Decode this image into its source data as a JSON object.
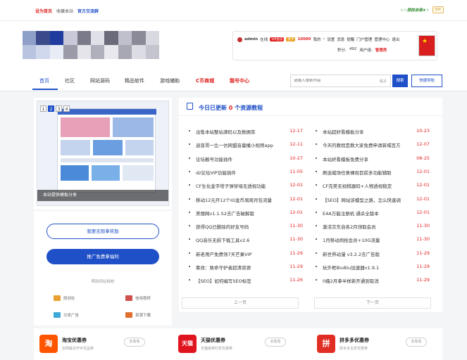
{
  "topbar": {
    "set_home": "设为首页",
    "bookmark": "收藏本站",
    "official": "官方交流群",
    "slogan": "☆☆授技自我★☆",
    "diy": "DIY"
  },
  "colors": {
    "primary": "#2050c8",
    "red": "#e02222",
    "tmall": "#e0141e",
    "taobao": "#ff5500",
    "pdd": "#e02e24"
  },
  "user": {
    "name": "admin",
    "status": "在线",
    "badge": "VIP会员",
    "gold": "金币",
    "coins": "10000",
    "my": "我的",
    "links": [
      "设置",
      "消息",
      "提醒",
      "门户管理",
      "管理中心",
      "退出"
    ],
    "score_label": "积分:",
    "score": "492",
    "group_label": "用户组:",
    "group": "管理员"
  },
  "nav": {
    "items": [
      "首页",
      "社区",
      "网站源码",
      "精品软件",
      "游戏辅助",
      "C币商城",
      "靓号中心"
    ],
    "search_placeholder": "请输入搜索内容",
    "search_type": "帖子",
    "search_btn": "搜索",
    "quick_nav": "快捷导航"
  },
  "slider": {
    "pages": [
      "1",
      "2",
      "3",
      "4"
    ],
    "caption": "本站提供模板分享"
  },
  "leftpanel": {
    "btn_outline": "我要无限拿奖励",
    "btn_solid": "推广免费拿福利",
    "section_label": "帮助网站梅校",
    "links": [
      "原创社",
      "信用搭桥",
      "分发广告",
      "资源下载"
    ]
  },
  "updates": {
    "title_prefix": "今日已更新",
    "count": "0",
    "title_suffix": "个资源教程",
    "left": [
      {
        "title": "出售本站整站源码以及数据库",
        "date": "12-17"
      },
      {
        "title": "迪普哥一比一仿网盟音量播小视频app",
        "date": "12-11"
      },
      {
        "title": "论坛靓号功能插件",
        "date": "10-27"
      },
      {
        "title": "dz论坛VIP功能插件",
        "date": "11-05"
      },
      {
        "title": "CF生化金字塔子弹穿墙无透视功能",
        "date": "12-01"
      },
      {
        "title": "移动12元开12个IG金币周周月包流量",
        "date": "12-01"
      },
      {
        "title": "美丽网v1.1.52去广告破解版",
        "date": "12-01"
      },
      {
        "title": "获得QQ已删除的好友号码",
        "date": "11-30"
      },
      {
        "title": "QQ音乐无损下载工具v2.6",
        "date": "11-30"
      },
      {
        "title": "新老用户免费领7天芒果VIP",
        "date": "11-29"
      },
      {
        "title": "筹改：致命守护者超清资源",
        "date": "11-29"
      },
      {
        "title": "【SEO】如何编写SEO标签",
        "date": "11-26"
      }
    ],
    "right": [
      {
        "title": "本站超好看模板分享",
        "date": "10-23"
      },
      {
        "title": "今天的教程是教大家免费申请新域百方",
        "date": "12-07"
      },
      {
        "title": "本站好看模板免费分享",
        "date": "08-25"
      },
      {
        "title": "刷选城场任意裸视目前多功能辅助",
        "date": "12-01"
      },
      {
        "title": "CF完美无视棋器码+人物透视稳定",
        "date": "12-01"
      },
      {
        "title": "【SEO】网站该模型之路，怎么快速调",
        "date": "12-01"
      },
      {
        "title": "E4A万能注册机 通杀全版本",
        "date": "12-01"
      },
      {
        "title": "激活京东自各2月领取会员",
        "date": "11-30"
      },
      {
        "title": "1月移动闹抢会员+10G流量",
        "date": "11-30"
      },
      {
        "title": "新世界动漫 v3.2.2去广告版",
        "date": "11-29"
      },
      {
        "title": "玩外框BiuBiu加速器v1.9.1",
        "date": "11-29"
      },
      {
        "title": "0撸2月拿半样新开通到取消",
        "date": "11-29"
      }
    ],
    "prev": "上一页",
    "next": "下一页"
  },
  "coupons": [
    {
      "logo": "淘",
      "title": "淘宝优惠券",
      "sub": "全网最多开手优品券",
      "btn": "去看看"
    },
    {
      "logo": "天猫",
      "title": "天猫优惠券",
      "sub": "天猫各种打折优惠券",
      "btn": "去看看"
    },
    {
      "logo": "拼",
      "title": "拼多多优惠券",
      "sub": "拼多多五折优惠券",
      "btn": "去看看"
    }
  ]
}
